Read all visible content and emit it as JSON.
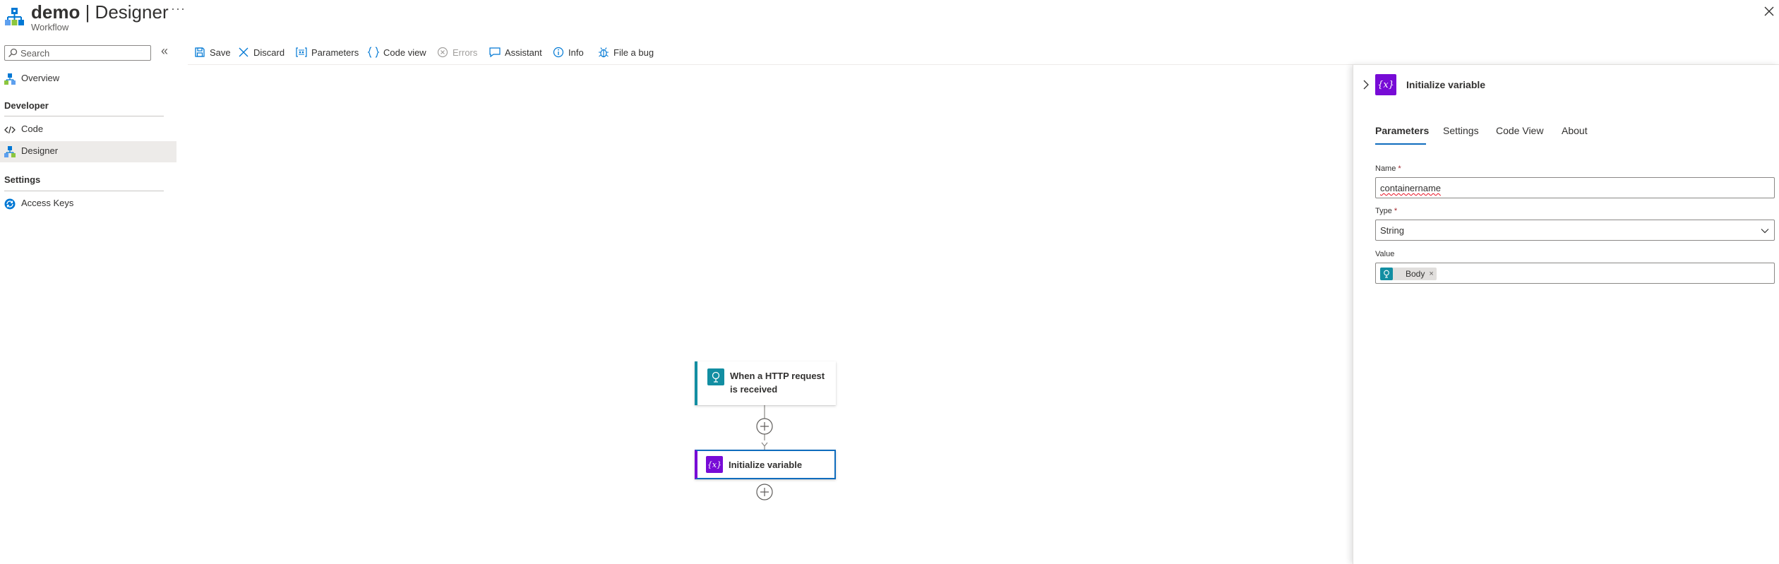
{
  "header": {
    "title_bold": "demo",
    "title_rest": " | Designer",
    "subtitle": "Workflow",
    "more": "···"
  },
  "sidebar": {
    "search_placeholder": "Search",
    "collapse": "«",
    "items": [
      {
        "label": "Overview",
        "icon": "overview-icon"
      },
      {
        "label": "Code",
        "icon": "code-icon"
      },
      {
        "label": "Designer",
        "icon": "designer-icon"
      },
      {
        "label": "Access Keys",
        "icon": "access-keys-icon"
      }
    ],
    "sections": [
      "Developer",
      "Settings"
    ],
    "active_item": "Designer"
  },
  "toolbar": {
    "save": "Save",
    "discard": "Discard",
    "parameters": "Parameters",
    "code_view": "Code view",
    "errors": "Errors",
    "assistant": "Assistant",
    "info": "Info",
    "file_bug": "File a bug"
  },
  "canvas": {
    "trigger": {
      "label": "When a HTTP request is received",
      "line1": "When a HTTP request",
      "line2": "is received",
      "color": "#128ea2"
    },
    "action": {
      "label": "Initialize variable",
      "color": "#770bd6"
    }
  },
  "panel": {
    "title": "Initialize variable",
    "tabs": [
      "Parameters",
      "Settings",
      "Code View",
      "About"
    ],
    "selected_tab": "Parameters",
    "fields": {
      "name": {
        "label": "Name",
        "required": "*",
        "value": "containername"
      },
      "type": {
        "label": "Type",
        "required": "*",
        "value": "String"
      },
      "value": {
        "label": "Value",
        "token": "Body",
        "token_remove": "×"
      }
    }
  },
  "colors": {
    "accent": "#0f6cbd",
    "variable": "#770bd6",
    "request": "#128ea2",
    "required": "#a4262c"
  }
}
